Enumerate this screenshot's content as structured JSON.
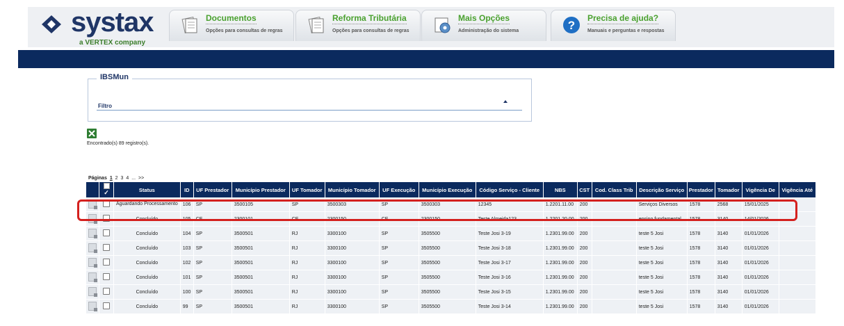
{
  "brand": {
    "name": "systax",
    "tagline": "a VERTEX company"
  },
  "nav": [
    {
      "title": "Documentos",
      "subtitle": "Opções para consultas de regras",
      "icon": "documents-icon"
    },
    {
      "title": "Reforma Tributária",
      "subtitle": "Opções para consultas de regras",
      "icon": "documents-icon"
    },
    {
      "title": "Mais Opções",
      "subtitle": "Administração do sistema",
      "icon": "gears-icon"
    },
    {
      "title": "Precisa de ajuda?",
      "subtitle": "Manuais e perguntas e respostas",
      "icon": "help-icon"
    }
  ],
  "section": {
    "legend": "IBSMun",
    "filter_label": "Filtro"
  },
  "results": {
    "found_text": "Encontrado(s) 89 registro(s)."
  },
  "pagination": {
    "label": "Páginas",
    "pages": [
      "1",
      "2",
      "3",
      "4",
      "..."
    ],
    "next": ">>"
  },
  "table": {
    "columns": [
      "Status",
      "ID",
      "UF Prestador",
      "Município Prestador",
      "UF Tomador",
      "Município Tomador",
      "UF Execução",
      "Município Execução",
      "Código Serviço - Cliente",
      "NBS",
      "CST",
      "Cod. Class Trib",
      "Descrição Serviço",
      "Prestador",
      "Tomador",
      "Vigência De",
      "Vigência Até"
    ],
    "rows": [
      {
        "status": "Aguardando Processamento",
        "id": "106",
        "uf_prestador": "SP",
        "mun_prestador": "3500105",
        "uf_tomador": "SP",
        "mun_tomador": "3500303",
        "uf_execucao": "SP",
        "mun_execucao": "3500303",
        "codigo": "12345",
        "nbs": "1.2201.11.00",
        "cst": "200",
        "class_trib": "",
        "descricao": "Serviços Diversos",
        "prestador": "1578",
        "tomador": "2568",
        "vig_de": "15/01/2025",
        "vig_ate": ""
      },
      {
        "status": "Concluído",
        "id": "105",
        "uf_prestador": "CE",
        "mun_prestador": "2300101",
        "uf_tomador": "CE",
        "mun_tomador": "2300150",
        "uf_execucao": "CE",
        "mun_execucao": "2300150",
        "codigo": "Teste Almeida123",
        "nbs": "1.2201.20.00",
        "cst": "200",
        "class_trib": "",
        "descricao": "ensino fundamental",
        "prestador": "1578",
        "tomador": "3140",
        "vig_de": "14/01/2026",
        "vig_ate": ""
      },
      {
        "status": "Concluído",
        "id": "104",
        "uf_prestador": "SP",
        "mun_prestador": "3500501",
        "uf_tomador": "RJ",
        "mun_tomador": "3300100",
        "uf_execucao": "SP",
        "mun_execucao": "3505500",
        "codigo": "Teste Josi 3-19",
        "nbs": "1.2301.99.00",
        "cst": "200",
        "class_trib": "",
        "descricao": "teste 5 Josi",
        "prestador": "1578",
        "tomador": "3140",
        "vig_de": "01/01/2026",
        "vig_ate": ""
      },
      {
        "status": "Concluído",
        "id": "103",
        "uf_prestador": "SP",
        "mun_prestador": "3500501",
        "uf_tomador": "RJ",
        "mun_tomador": "3300100",
        "uf_execucao": "SP",
        "mun_execucao": "3505500",
        "codigo": "Teste Josi 3-18",
        "nbs": "1.2301.99.00",
        "cst": "200",
        "class_trib": "",
        "descricao": "teste 5 Josi",
        "prestador": "1578",
        "tomador": "3140",
        "vig_de": "01/01/2026",
        "vig_ate": ""
      },
      {
        "status": "Concluído",
        "id": "102",
        "uf_prestador": "SP",
        "mun_prestador": "3500501",
        "uf_tomador": "RJ",
        "mun_tomador": "3300100",
        "uf_execucao": "SP",
        "mun_execucao": "3505500",
        "codigo": "Teste Josi 3-17",
        "nbs": "1.2301.99.00",
        "cst": "200",
        "class_trib": "",
        "descricao": "teste 5 Josi",
        "prestador": "1578",
        "tomador": "3140",
        "vig_de": "01/01/2026",
        "vig_ate": ""
      },
      {
        "status": "Concluído",
        "id": "101",
        "uf_prestador": "SP",
        "mun_prestador": "3500501",
        "uf_tomador": "RJ",
        "mun_tomador": "3300100",
        "uf_execucao": "SP",
        "mun_execucao": "3505500",
        "codigo": "Teste Josi 3-16",
        "nbs": "1.2301.99.00",
        "cst": "200",
        "class_trib": "",
        "descricao": "teste 5 Josi",
        "prestador": "1578",
        "tomador": "3140",
        "vig_de": "01/01/2026",
        "vig_ate": ""
      },
      {
        "status": "Concluído",
        "id": "100",
        "uf_prestador": "SP",
        "mun_prestador": "3500501",
        "uf_tomador": "RJ",
        "mun_tomador": "3300100",
        "uf_execucao": "SP",
        "mun_execucao": "3505500",
        "codigo": "Teste Josi 3-15",
        "nbs": "1.2301.99.00",
        "cst": "200",
        "class_trib": "",
        "descricao": "teste 5 Josi",
        "prestador": "1578",
        "tomador": "3140",
        "vig_de": "01/01/2026",
        "vig_ate": ""
      },
      {
        "status": "Concluído",
        "id": "99",
        "uf_prestador": "SP",
        "mun_prestador": "3500501",
        "uf_tomador": "RJ",
        "mun_tomador": "3300100",
        "uf_execucao": "SP",
        "mun_execucao": "3505500",
        "codigo": "Teste Josi 3-14",
        "nbs": "1.2301.99.00",
        "cst": "200",
        "class_trib": "",
        "descricao": "teste 5 Josi",
        "prestador": "1578",
        "tomador": "3140",
        "vig_de": "01/01/2026",
        "vig_ate": ""
      }
    ]
  },
  "colors": {
    "brand_navy": "#0b2a5e",
    "nav_green": "#4aa12f",
    "highlight_red": "#d4201e",
    "row_bg": "#eef1f5"
  }
}
